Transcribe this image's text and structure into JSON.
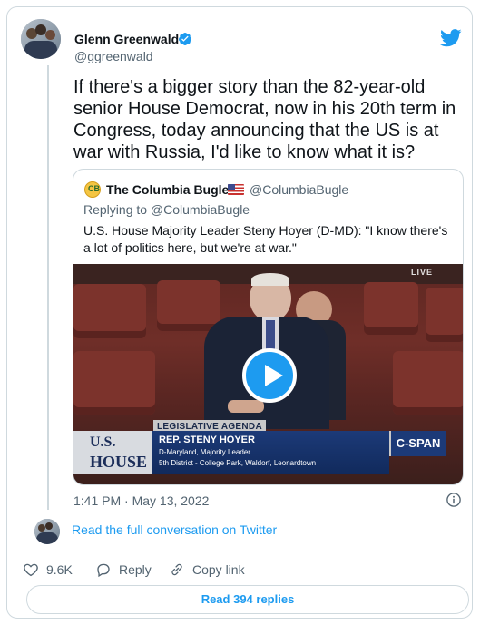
{
  "tweet": {
    "author_name": "Glenn Greenwald",
    "author_handle": "@ggreenwald",
    "text": "If there's a bigger story than the 82-year-old senior House Democrat, now in his 20th term in Congress, today announcing that the US is at war with Russia, I'd like to know what it is?",
    "timestamp": "1:41 PM · May 13, 2022"
  },
  "quote": {
    "author_name": "The Columbia Bugle",
    "author_handle": "@ColumbiaBugle",
    "replying_to": "Replying to @ColumbiaBugle",
    "text": "U.S. House Majority Leader Steny Hoyer (D-MD): \"I know there's a lot of politics here, but we're at war.\"",
    "video": {
      "live_label": "LIVE",
      "chyron_tag": "LEGISLATIVE AGENDA",
      "chyron_logo_line1": "U.S.",
      "chyron_logo_line2": "HOUSE",
      "chyron_name": "REP. STENY HOYER",
      "chyron_sub1": "D-Maryland, Majority Leader",
      "chyron_sub2": "5th District - College Park, Waldorf, Leonardtown",
      "network": "C-SPAN"
    }
  },
  "footer": {
    "read_conversation": "Read the full conversation on Twitter",
    "likes": "9.6K",
    "reply_label": "Reply",
    "copy_link_label": "Copy link",
    "read_replies": "Read 394 replies"
  },
  "icons": {
    "twitter": "twitter-bird-icon",
    "verified": "verified-badge-icon",
    "info": "info-icon",
    "heart": "heart-icon",
    "reply": "reply-bubble-icon",
    "link": "link-icon",
    "play": "play-icon"
  },
  "colors": {
    "accent": "#1d9bf0",
    "text_primary": "#0f1419",
    "text_secondary": "#536471",
    "border": "#cfd9de"
  }
}
